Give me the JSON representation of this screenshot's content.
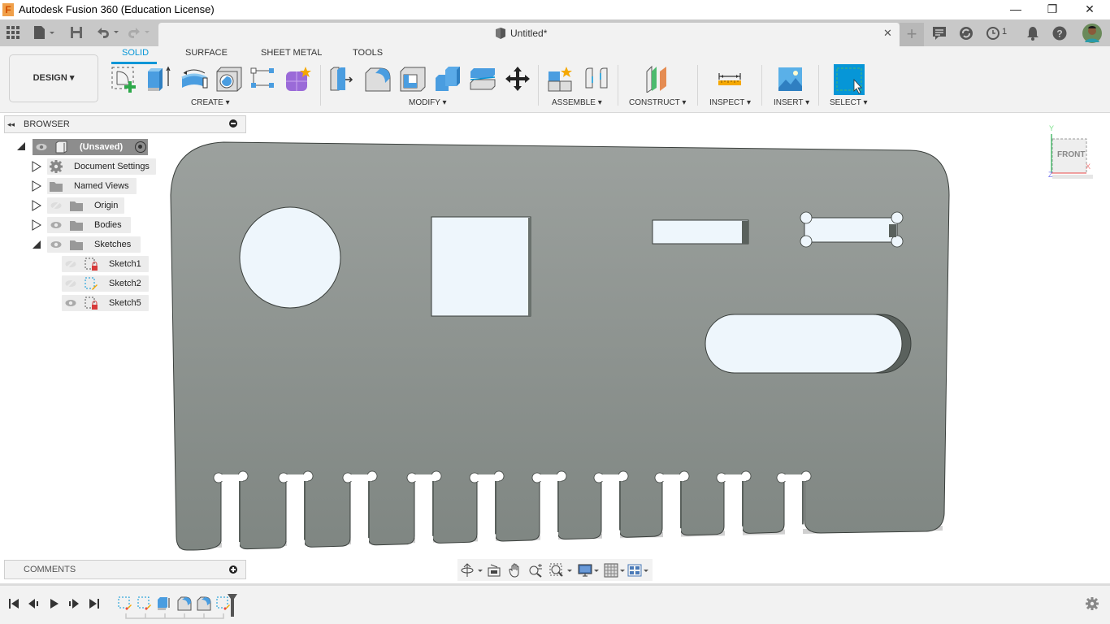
{
  "window": {
    "title": "Autodesk Fusion 360 (Education License)",
    "app_logo": "F",
    "minimize": "—",
    "restore": "❐",
    "close": "✕"
  },
  "quick_access": {
    "grid_icon": "apps-grid-icon",
    "file_icon": "file-icon",
    "save_icon": "save-icon",
    "undo_icon": "undo-icon",
    "redo_icon": "redo-icon"
  },
  "document_tab": {
    "title": "Untitled*",
    "close": "✕",
    "new_tab": "+"
  },
  "header_right": {
    "job_count": "1"
  },
  "ribbon": {
    "workspace": "DESIGN ▾",
    "tabs": [
      {
        "label": "SOLID",
        "active": true
      },
      {
        "label": "SURFACE",
        "active": false
      },
      {
        "label": "SHEET METAL",
        "active": false
      },
      {
        "label": "TOOLS",
        "active": false
      }
    ],
    "groups": [
      {
        "label": "CREATE ▾"
      },
      {
        "label": "MODIFY ▾"
      },
      {
        "label": "ASSEMBLE ▾"
      },
      {
        "label": "CONSTRUCT ▾"
      },
      {
        "label": "INSPECT ▾"
      },
      {
        "label": "INSERT ▾"
      },
      {
        "label": "SELECT ▾"
      }
    ],
    "accent": "#0696d7"
  },
  "browser": {
    "title": "BROWSER",
    "root": "(Unsaved)",
    "items": [
      {
        "label": "Document Settings"
      },
      {
        "label": "Named Views"
      },
      {
        "label": "Origin"
      },
      {
        "label": "Bodies"
      },
      {
        "label": "Sketches"
      }
    ],
    "sketches": [
      {
        "label": "Sketch1",
        "visible": false
      },
      {
        "label": "Sketch2",
        "visible": false
      },
      {
        "label": "Sketch5",
        "visible": true
      }
    ]
  },
  "viewcube": {
    "face": "FRONT",
    "axis_y": "Y",
    "axis_x": "X",
    "axis_z": "Z"
  },
  "comments": {
    "title": "COMMENTS"
  },
  "timeline": {
    "features": [
      "sketch",
      "sketch",
      "extrude",
      "fillet",
      "fillet",
      "sketch"
    ]
  },
  "colors": {
    "body": "#8a918d",
    "hole": "#eef6fc",
    "select_active": "#0696d7"
  }
}
